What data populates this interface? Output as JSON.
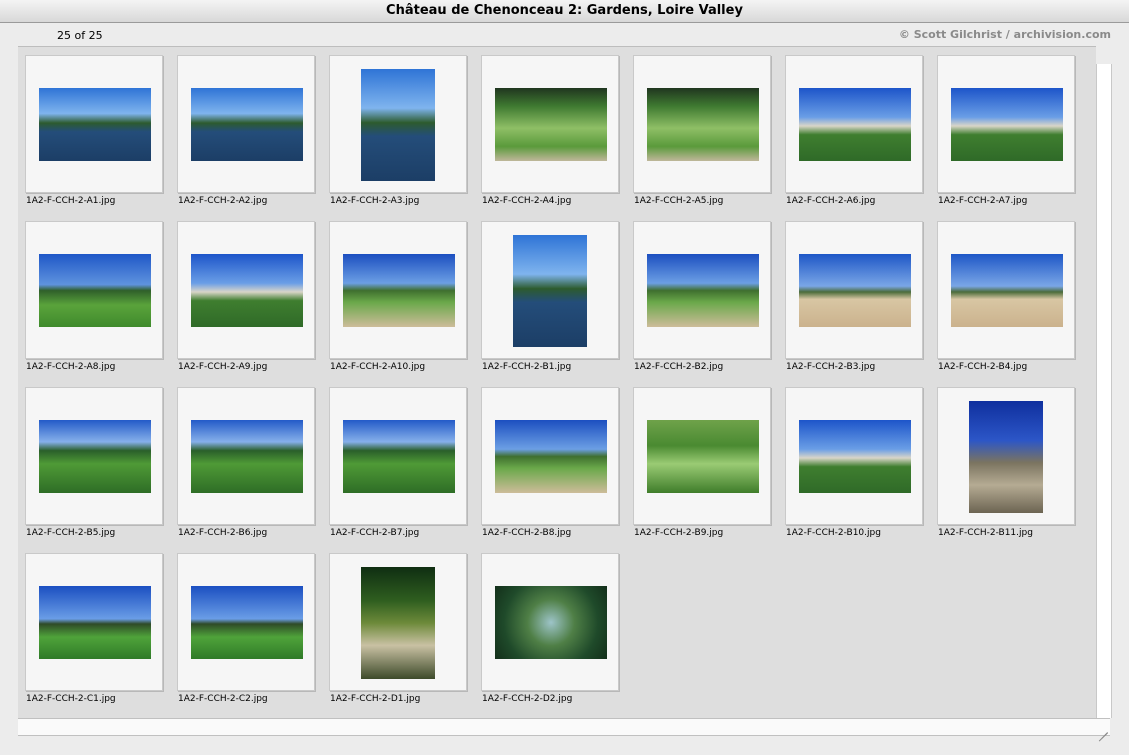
{
  "window": {
    "title": "Château de Chenonceau 2: Gardens, Loire Valley",
    "count": "25 of 25",
    "credit": "© Scott Gilchrist / archivision.com"
  },
  "thumbnails": [
    {
      "file": "1A2-F-CCH-2-A1.jpg",
      "orientation": "landscape",
      "scene": "water"
    },
    {
      "file": "1A2-F-CCH-2-A2.jpg",
      "orientation": "landscape",
      "scene": "water"
    },
    {
      "file": "1A2-F-CCH-2-A3.jpg",
      "orientation": "portrait",
      "scene": "water"
    },
    {
      "file": "1A2-F-CCH-2-A4.jpg",
      "orientation": "landscape",
      "scene": "parterre"
    },
    {
      "file": "1A2-F-CCH-2-A5.jpg",
      "orientation": "landscape",
      "scene": "parterre"
    },
    {
      "file": "1A2-F-CCH-2-A6.jpg",
      "orientation": "landscape",
      "scene": "chateau"
    },
    {
      "file": "1A2-F-CCH-2-A7.jpg",
      "orientation": "landscape",
      "scene": "chateau"
    },
    {
      "file": "1A2-F-CCH-2-A8.jpg",
      "orientation": "landscape",
      "scene": "lawn"
    },
    {
      "file": "1A2-F-CCH-2-A9.jpg",
      "orientation": "landscape",
      "scene": "chateau"
    },
    {
      "file": "1A2-F-CCH-2-A10.jpg",
      "orientation": "landscape",
      "scene": "path"
    },
    {
      "file": "1A2-F-CCH-2-B1.jpg",
      "orientation": "portrait",
      "scene": "water"
    },
    {
      "file": "1A2-F-CCH-2-B2.jpg",
      "orientation": "landscape",
      "scene": "path"
    },
    {
      "file": "1A2-F-CCH-2-B3.jpg",
      "orientation": "landscape",
      "scene": "sand"
    },
    {
      "file": "1A2-F-CCH-2-B4.jpg",
      "orientation": "landscape",
      "scene": "sand"
    },
    {
      "file": "1A2-F-CCH-2-B5.jpg",
      "orientation": "landscape",
      "scene": "garden"
    },
    {
      "file": "1A2-F-CCH-2-B6.jpg",
      "orientation": "landscape",
      "scene": "garden"
    },
    {
      "file": "1A2-F-CCH-2-B7.jpg",
      "orientation": "landscape",
      "scene": "garden"
    },
    {
      "file": "1A2-F-CCH-2-B8.jpg",
      "orientation": "landscape",
      "scene": "path"
    },
    {
      "file": "1A2-F-CCH-2-B9.jpg",
      "orientation": "landscape",
      "scene": "knot"
    },
    {
      "file": "1A2-F-CCH-2-B10.jpg",
      "orientation": "landscape",
      "scene": "chateau"
    },
    {
      "file": "1A2-F-CCH-2-B11.jpg",
      "orientation": "portrait",
      "scene": "bridge"
    },
    {
      "file": "1A2-F-CCH-2-C1.jpg",
      "orientation": "landscape",
      "scene": "stable"
    },
    {
      "file": "1A2-F-CCH-2-C2.jpg",
      "orientation": "landscape",
      "scene": "stable"
    },
    {
      "file": "1A2-F-CCH-2-D1.jpg",
      "orientation": "portrait",
      "scene": "forest"
    },
    {
      "file": "1A2-F-CCH-2-D2.jpg",
      "orientation": "landscape",
      "scene": "canopy"
    }
  ],
  "colors": {
    "credit": "#8a8a8a",
    "pane": "#dedede",
    "slide": "#f6f6f6"
  }
}
